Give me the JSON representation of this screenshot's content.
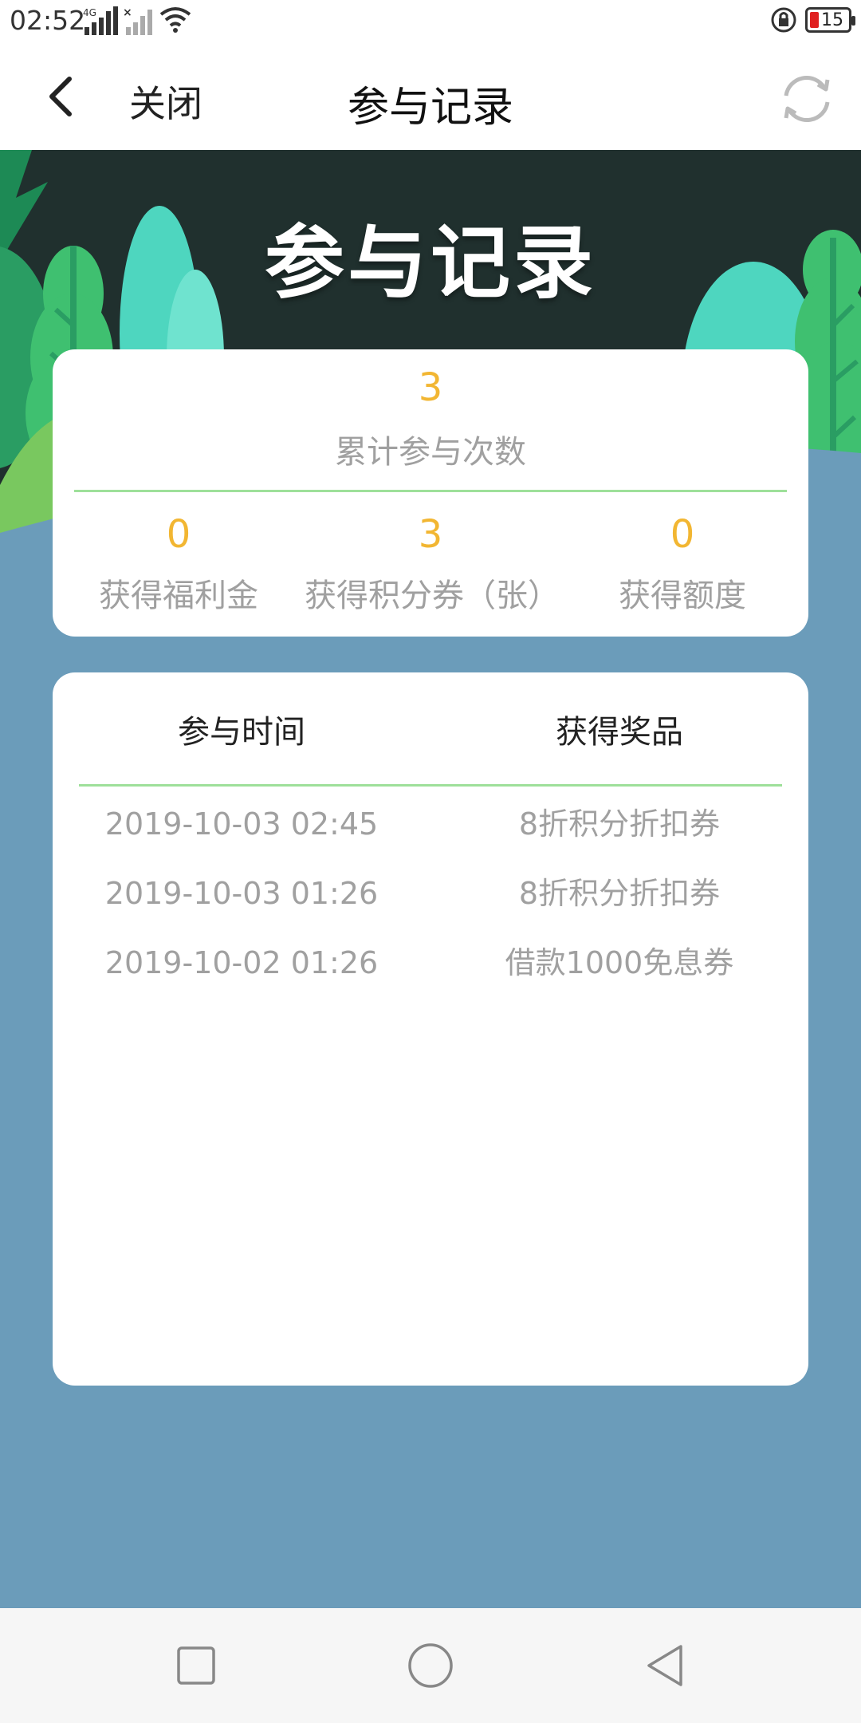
{
  "status_bar": {
    "time": "02:52",
    "network_label": "4G",
    "battery_level": "15",
    "icons": [
      "signal-icon",
      "no-signal-icon",
      "wifi-icon",
      "rotation-lock-icon",
      "battery-icon"
    ]
  },
  "nav": {
    "close_label": "关闭",
    "title": "参与记录",
    "icons": [
      "back-arrow-icon",
      "refresh-icon"
    ]
  },
  "banner": {
    "title": "参与记录"
  },
  "summary": {
    "total_count": "3",
    "total_label": "累计参与次数",
    "stats": [
      {
        "value": "0",
        "label": "获得福利金"
      },
      {
        "value": "3",
        "label": "获得积分券（张）"
      },
      {
        "value": "0",
        "label": "获得额度"
      }
    ]
  },
  "records": {
    "headers": {
      "time": "参与时间",
      "prize": "获得奖品"
    },
    "rows": [
      {
        "time": "2019-10-03 02:45",
        "prize": "8折积分折扣券"
      },
      {
        "time": "2019-10-03 01:26",
        "prize": "8折积分折扣券"
      },
      {
        "time": "2019-10-02 01:26",
        "prize": "借款1000免息券"
      }
    ]
  },
  "bottom_nav": {
    "icons": [
      "recent-apps-icon",
      "home-icon",
      "back-icon"
    ]
  },
  "colors": {
    "accent": "#f2b632",
    "divider": "#9ee09a",
    "page_background": "#6b9cba",
    "banner_dark": "#20302e"
  }
}
